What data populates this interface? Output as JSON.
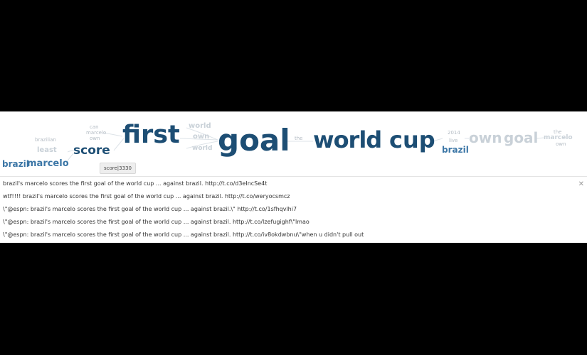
{
  "wordtree": {
    "left_words": [
      {
        "text": "brazil",
        "key": "brazil-left"
      },
      {
        "text": "marcelo",
        "key": "marcelo-left"
      },
      {
        "text": "brazilian",
        "key": "brazilian"
      },
      {
        "text": "least",
        "key": "least"
      },
      {
        "text": "score",
        "key": "score"
      },
      {
        "text": "can",
        "key": "can"
      },
      {
        "text": "marcelo",
        "key": "marcelo-small"
      },
      {
        "text": "own",
        "key": "own-small"
      },
      {
        "text": "first",
        "key": "first"
      }
    ],
    "middle_words": [
      {
        "text": "world",
        "key": "world-upper"
      },
      {
        "text": "own",
        "key": "own-middle"
      },
      {
        "text": "world",
        "key": "world-lower"
      },
      {
        "text": "goal",
        "key": "goal"
      },
      {
        "text": "the",
        "key": "the-small"
      }
    ],
    "right_words": [
      {
        "text": "world",
        "key": "world-main"
      },
      {
        "text": "cup",
        "key": "cup"
      },
      {
        "text": "2014",
        "key": "year"
      },
      {
        "text": "live",
        "key": "live"
      },
      {
        "text": "brazil",
        "key": "brazil-right"
      },
      {
        "text": "own",
        "key": "own-right"
      },
      {
        "text": "goal",
        "key": "goal-right"
      },
      {
        "text": "the",
        "key": "the-right"
      },
      {
        "text": "marcelo",
        "key": "marcelo-right"
      },
      {
        "text": "own",
        "key": "own-far"
      }
    ],
    "tooltip": "score|3330"
  },
  "tweets": [
    "brazil's marcelo scores the first goal of the world cup ... against brazil. http://t.co/d3eIncSe4t",
    "wtf!!!! brazil's marcelo scores the first goal of the world cup ... against brazil. http://t.co/weryocsmcz",
    "\\\"@espn: brazil's marcelo scores the first goal of the world cup ... against brazil.\\\" http://t.co/1sfhqvlhi7",
    "\\\"@espn: brazil's marcelo scores the first goal of the world cup ... against brazil. http://t.co/lzefugighf\\\"lmao",
    "\\\"@espn: brazil's marcelo scores the first goal of the world cup ... against brazil. http://t.co/iv8okdwbnu\\\"when u didn't pull out"
  ],
  "close_icon": "close-icon",
  "colors": {
    "dark": "#1d4e74",
    "blue": "#3b76a6",
    "faint": "#c9d1d8",
    "background": "#000000"
  }
}
